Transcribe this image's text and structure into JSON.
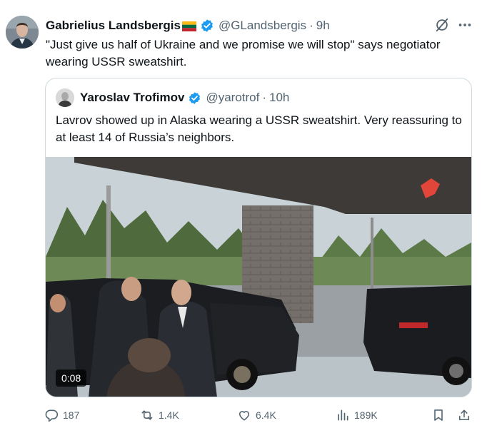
{
  "tweet": {
    "author_name": "Gabrielius Landsbergis",
    "author_handle": "@GLandsbergis",
    "separator": "·",
    "time": "9h",
    "text": "\"Just give us half of Ukraine and we promise we will stop\" says negotiator wearing USSR sweatshirt."
  },
  "quote": {
    "author_name": "Yaroslav Trofimov",
    "author_handle": "@yarotrof",
    "separator": "·",
    "time": "10h",
    "text": "Lavrov showed up in Alaska wearing a USSR sweatshirt. Very reassuring to at least 14 of Russia’s neighbors.",
    "video_duration": "0:08"
  },
  "actions": {
    "replies": "187",
    "reposts": "1.4K",
    "likes": "6.4K",
    "views": "189K"
  },
  "icons": {
    "author_avatar": "avatar",
    "flag": "lithuania-flag-icon",
    "verified": "verified-badge-icon",
    "grok": "grok-icon",
    "more": "more-icon",
    "reply": "reply-icon",
    "repost": "repost-icon",
    "like": "heart-icon",
    "views": "views-icon",
    "bookmark": "bookmark-icon",
    "share": "share-icon"
  },
  "colors": {
    "text": "#0f1419",
    "secondary": "#536471",
    "verified": "#1d9bf0",
    "border": "#cfd9de"
  }
}
